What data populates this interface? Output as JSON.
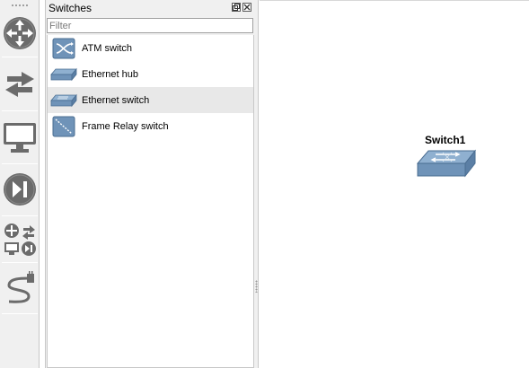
{
  "toolbar": {
    "buttons": [
      {
        "name": "routers-category-icon"
      },
      {
        "name": "switches-category-icon"
      },
      {
        "name": "end-devices-category-icon"
      },
      {
        "name": "security-devices-category-icon"
      },
      {
        "name": "all-devices-category-icon"
      },
      {
        "name": "add-link-icon"
      }
    ]
  },
  "dock": {
    "title": "Switches",
    "filter_placeholder": "Filter",
    "filter_value": "",
    "items": [
      {
        "label": "ATM switch",
        "icon": "atm-switch-icon",
        "selected": false
      },
      {
        "label": "Ethernet hub",
        "icon": "ethernet-hub-icon",
        "selected": false
      },
      {
        "label": "Ethernet switch",
        "icon": "ethernet-switch-icon",
        "selected": true
      },
      {
        "label": "Frame Relay switch",
        "icon": "frame-relay-switch-icon",
        "selected": false
      }
    ]
  },
  "canvas": {
    "nodes": [
      {
        "label": "Switch1",
        "icon": "ethernet-switch-icon"
      }
    ]
  },
  "colors": {
    "device_blue": "#6f93b8",
    "device_dark": "#4a6d91",
    "toolbar_icon": "#6b6b6b"
  }
}
